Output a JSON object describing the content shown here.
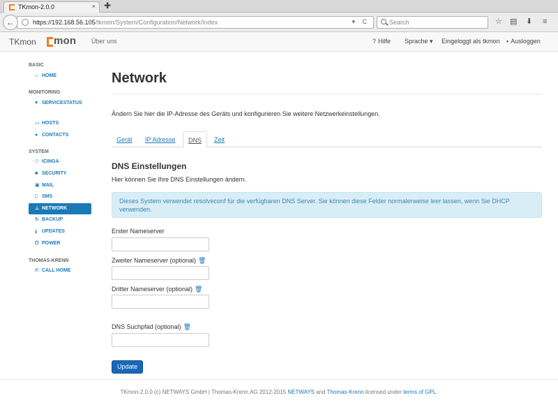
{
  "browser": {
    "tab_title": "TKmon-2.0.0",
    "tab_close": "×",
    "new_tab": "✚",
    "url_host": "https://192.168.56.105",
    "url_path": "/tkmon/System/Configuration/Network/Index",
    "url_tools": "▾ C",
    "search_placeholder": "Search"
  },
  "header": {
    "brand": "TKmon",
    "logo_text": "mon",
    "about": "Über uns",
    "help": "Hilfe",
    "language": "Sprache ▾",
    "logged_in": "Eingeloggt als tkmon",
    "logout": "Ausloggen"
  },
  "sidebar": {
    "sections": [
      {
        "title": "BASIC"
      },
      {
        "title": "MONITORING"
      },
      {
        "title": "SYSTEM"
      },
      {
        "title": "THOMAS-KRENN"
      }
    ],
    "items": [
      {
        "label": "HOME",
        "icon": "home-icon",
        "glyph": "⌂"
      },
      {
        "label": "SERVICESTATUS",
        "icon": "heart-icon",
        "glyph": "♥"
      },
      {
        "label": "HOSTS",
        "icon": "monitor-icon",
        "glyph": "▭"
      },
      {
        "label": "CONTACTS",
        "icon": "user-icon",
        "glyph": "●"
      },
      {
        "label": "ICINGA",
        "icon": "icinga-icon",
        "glyph": "⁘"
      },
      {
        "label": "SECURITY",
        "icon": "lock-icon",
        "glyph": "■"
      },
      {
        "label": "MAIL",
        "icon": "inbox-icon",
        "glyph": "▣"
      },
      {
        "label": "SMS",
        "icon": "phone-icon",
        "glyph": "▯"
      },
      {
        "label": "NETWORK",
        "icon": "network-icon",
        "glyph": "⊥"
      },
      {
        "label": "BACKUP",
        "icon": "refresh-icon",
        "glyph": "↻"
      },
      {
        "label": "UPDATES",
        "icon": "download-icon",
        "glyph": "⤓"
      },
      {
        "label": "POWER",
        "icon": "power-icon",
        "glyph": "⏻"
      },
      {
        "label": "CALL HOME",
        "icon": "phone-handset-icon",
        "glyph": "✆"
      }
    ]
  },
  "main": {
    "title": "Network",
    "intro": "Ändern Sie hier die IP-Adresse des Geräts und konfigurieren Sie weitere Netzwerkeinstellungen.",
    "tabs": [
      {
        "label": "Gerät"
      },
      {
        "label": "IP Adresse"
      },
      {
        "label": "DNS"
      },
      {
        "label": "Zeit"
      }
    ],
    "active_tab": "DNS",
    "section_title": "DNS Einstellungen",
    "section_desc": "Hier können Sie Ihre DNS Einstellungen ändern.",
    "alert": "Dieses System verwendet resolveconf für die verfügbaren DNS Server. Sie können diese Felder normalerweise leer lassen, wenn Sie DHCP verwenden.",
    "fields": [
      {
        "label": "Erster Nameserver",
        "value": ""
      },
      {
        "label": "Zweiter Nameserver (optional)",
        "value": ""
      },
      {
        "label": "Dritter Nameserver (optional)",
        "value": ""
      },
      {
        "label": "DNS Suchpfad (optional)",
        "value": ""
      }
    ],
    "update_label": "Update"
  },
  "footer": {
    "text_start": "TKmon-2.0.0 (c) NETWAYS GmbH | Thomas-Krenn.AG 2012-2015 ",
    "link_netways": "NETWAYS",
    "and": " and ",
    "link_tk": "Thomas-Krenn",
    "licensed": " licensed under ",
    "link_gpl": "terms of GPL",
    "end": "."
  },
  "colors": {
    "accent": "#1a7ab8",
    "logo_orange": "#f07f1a",
    "alert_bg": "#d9edf7",
    "button": "#1867b8"
  }
}
